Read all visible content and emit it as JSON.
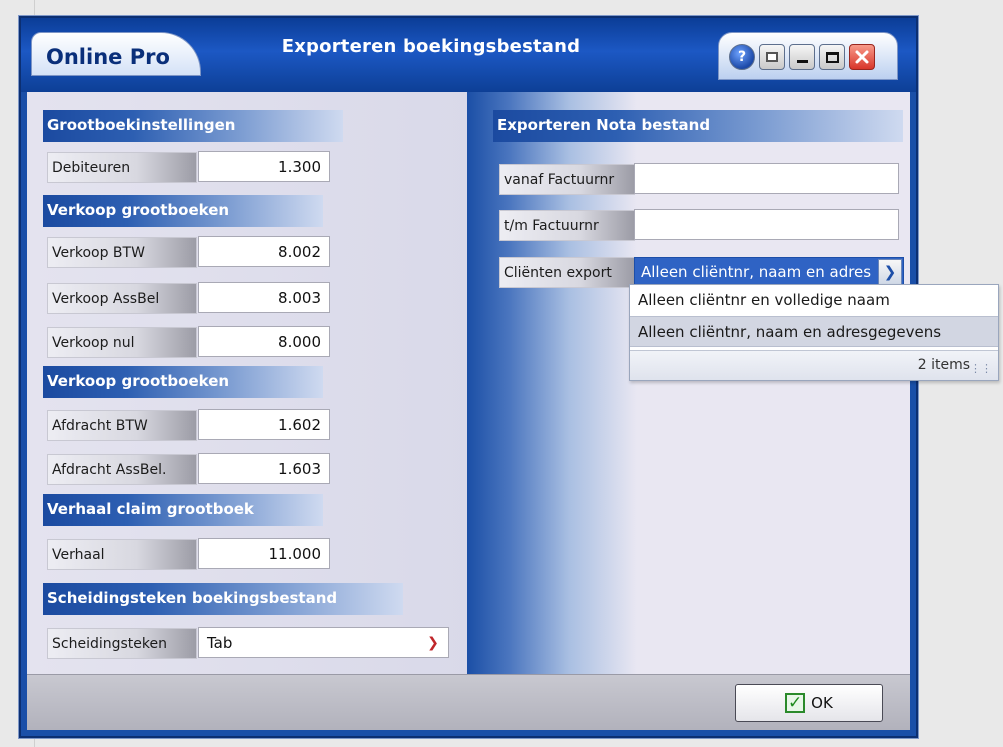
{
  "window": {
    "app_name": "Online Pro",
    "title": "Exporteren boekingsbestand",
    "buttons": {
      "help": "?"
    }
  },
  "left": {
    "ledger_settings": {
      "header": "Grootboekinstellingen",
      "debiteuren": {
        "label": "Debiteuren",
        "value": "1.300"
      }
    },
    "sales_ledgers": {
      "header": "Verkoop grootboeken",
      "verkoop_btw": {
        "label": "Verkoop BTW",
        "value": "8.002"
      },
      "verkoop_assbel": {
        "label": "Verkoop AssBel",
        "value": "8.003"
      },
      "verkoop_nul": {
        "label": "Verkoop nul",
        "value": "8.000"
      }
    },
    "remittance_ledgers": {
      "header": "Verkoop grootboeken",
      "afdracht_btw": {
        "label": "Afdracht BTW",
        "value": "1.602"
      },
      "afdracht_assbel": {
        "label": "Afdracht AssBel.",
        "value": "1.603"
      }
    },
    "claim_ledger": {
      "header": "Verhaal claim grootboek",
      "verhaal": {
        "label": "Verhaal",
        "value": "11.000"
      }
    },
    "separator": {
      "header": "Scheidingsteken boekingsbestand",
      "label": "Scheidingsteken",
      "value": "Tab"
    }
  },
  "right": {
    "header": "Exporteren Nota bestand",
    "vanaf_factuurnr": {
      "label": "vanaf Factuurnr",
      "value": ""
    },
    "tm_factuurnr": {
      "label": "t/m  Factuurnr",
      "value": ""
    },
    "clienten_export": {
      "label": "Cliënten export",
      "value": "Alleen cliëntnr, naam en adres",
      "options": [
        "Alleen cliëntnr en volledige naam",
        "Alleen cliëntnr, naam en adresgegevens"
      ],
      "count_text": "2 items"
    }
  },
  "footer": {
    "ok_label": "OK"
  },
  "colors": {
    "title_blue": "#1c58c4",
    "header_blue": "#1b4aa0",
    "select_highlight": "#2f63c4",
    "ok_check_green": "#2b8a2b",
    "close_red": "#d8362a"
  }
}
